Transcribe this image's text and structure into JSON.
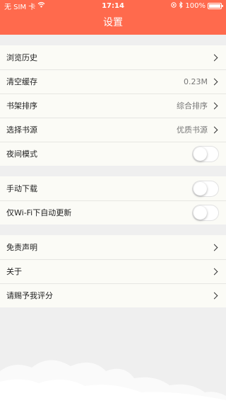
{
  "status_bar": {
    "carrier": "无 SIM 卡",
    "time": "17:14",
    "battery": "100%"
  },
  "nav": {
    "title": "设置"
  },
  "groups": [
    {
      "rows": [
        {
          "label": "浏览历史"
        },
        {
          "label": "清空缓存",
          "value": "0.23M"
        },
        {
          "label": "书架排序",
          "value": "综合排序"
        },
        {
          "label": "选择书源",
          "value": "优质书源"
        },
        {
          "label": "夜间模式",
          "toggle": false
        }
      ]
    },
    {
      "rows": [
        {
          "label": "手动下载",
          "toggle": false
        },
        {
          "label": "仅Wi-Fi下自动更新",
          "toggle": false
        }
      ]
    },
    {
      "rows": [
        {
          "label": "免责声明"
        },
        {
          "label": "关于"
        },
        {
          "label": "请赐予我评分"
        }
      ]
    }
  ],
  "colors": {
    "accent": "#ff6a4d",
    "background": "#efefef",
    "cell": "#fbfbf6"
  },
  "icons": [
    "wifi-icon",
    "location-icon",
    "bluetooth-icon",
    "battery-icon",
    "chevron-right-icon"
  ]
}
